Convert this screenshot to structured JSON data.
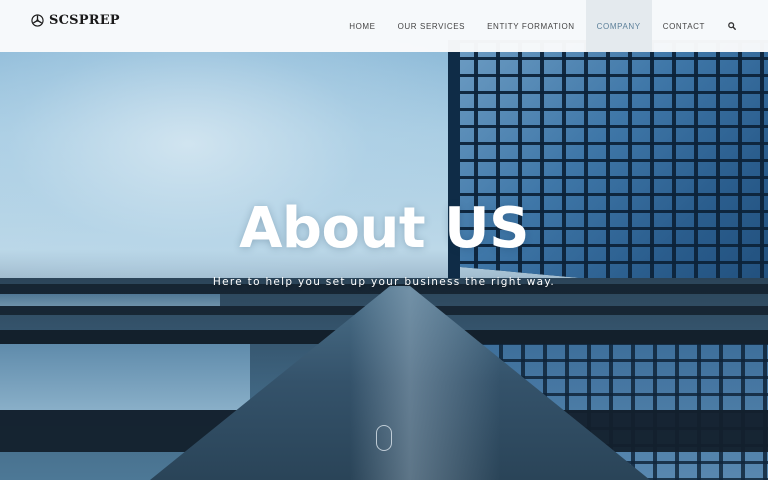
{
  "brand": {
    "logo_text": "SCSPREP",
    "logo_icon": "aircraft-propeller-icon"
  },
  "nav": {
    "items": [
      {
        "label": "HOME",
        "active": false
      },
      {
        "label": "OUR SERVICES",
        "active": false
      },
      {
        "label": "ENTITY FORMATION",
        "active": false
      },
      {
        "label": "COMPANY",
        "active": true
      },
      {
        "label": "CONTACT",
        "active": false
      }
    ],
    "search_icon": "search-icon"
  },
  "hero": {
    "title": "About US",
    "subtitle": "Here to help you set up your business the right way.",
    "scroll_icon": "mouse-scroll-icon"
  },
  "colors": {
    "nav_background": "#fafbfc",
    "nav_active_background": "#e4eaee",
    "nav_active_text": "#5b7f99",
    "hero_text": "#ffffff"
  }
}
